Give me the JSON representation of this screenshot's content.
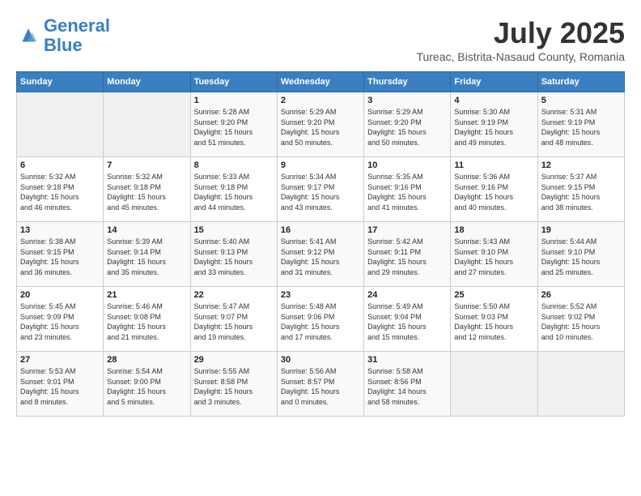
{
  "header": {
    "logo_line1": "General",
    "logo_line2": "Blue",
    "month": "July 2025",
    "location": "Tureac, Bistrita-Nasaud County, Romania"
  },
  "days_of_week": [
    "Sunday",
    "Monday",
    "Tuesday",
    "Wednesday",
    "Thursday",
    "Friday",
    "Saturday"
  ],
  "weeks": [
    [
      {
        "day": "",
        "info": ""
      },
      {
        "day": "",
        "info": ""
      },
      {
        "day": "1",
        "info": "Sunrise: 5:28 AM\nSunset: 9:20 PM\nDaylight: 15 hours\nand 51 minutes."
      },
      {
        "day": "2",
        "info": "Sunrise: 5:29 AM\nSunset: 9:20 PM\nDaylight: 15 hours\nand 50 minutes."
      },
      {
        "day": "3",
        "info": "Sunrise: 5:29 AM\nSunset: 9:20 PM\nDaylight: 15 hours\nand 50 minutes."
      },
      {
        "day": "4",
        "info": "Sunrise: 5:30 AM\nSunset: 9:19 PM\nDaylight: 15 hours\nand 49 minutes."
      },
      {
        "day": "5",
        "info": "Sunrise: 5:31 AM\nSunset: 9:19 PM\nDaylight: 15 hours\nand 48 minutes."
      }
    ],
    [
      {
        "day": "6",
        "info": "Sunrise: 5:32 AM\nSunset: 9:18 PM\nDaylight: 15 hours\nand 46 minutes."
      },
      {
        "day": "7",
        "info": "Sunrise: 5:32 AM\nSunset: 9:18 PM\nDaylight: 15 hours\nand 45 minutes."
      },
      {
        "day": "8",
        "info": "Sunrise: 5:33 AM\nSunset: 9:18 PM\nDaylight: 15 hours\nand 44 minutes."
      },
      {
        "day": "9",
        "info": "Sunrise: 5:34 AM\nSunset: 9:17 PM\nDaylight: 15 hours\nand 43 minutes."
      },
      {
        "day": "10",
        "info": "Sunrise: 5:35 AM\nSunset: 9:16 PM\nDaylight: 15 hours\nand 41 minutes."
      },
      {
        "day": "11",
        "info": "Sunrise: 5:36 AM\nSunset: 9:16 PM\nDaylight: 15 hours\nand 40 minutes."
      },
      {
        "day": "12",
        "info": "Sunrise: 5:37 AM\nSunset: 9:15 PM\nDaylight: 15 hours\nand 38 minutes."
      }
    ],
    [
      {
        "day": "13",
        "info": "Sunrise: 5:38 AM\nSunset: 9:15 PM\nDaylight: 15 hours\nand 36 minutes."
      },
      {
        "day": "14",
        "info": "Sunrise: 5:39 AM\nSunset: 9:14 PM\nDaylight: 15 hours\nand 35 minutes."
      },
      {
        "day": "15",
        "info": "Sunrise: 5:40 AM\nSunset: 9:13 PM\nDaylight: 15 hours\nand 33 minutes."
      },
      {
        "day": "16",
        "info": "Sunrise: 5:41 AM\nSunset: 9:12 PM\nDaylight: 15 hours\nand 31 minutes."
      },
      {
        "day": "17",
        "info": "Sunrise: 5:42 AM\nSunset: 9:11 PM\nDaylight: 15 hours\nand 29 minutes."
      },
      {
        "day": "18",
        "info": "Sunrise: 5:43 AM\nSunset: 9:10 PM\nDaylight: 15 hours\nand 27 minutes."
      },
      {
        "day": "19",
        "info": "Sunrise: 5:44 AM\nSunset: 9:10 PM\nDaylight: 15 hours\nand 25 minutes."
      }
    ],
    [
      {
        "day": "20",
        "info": "Sunrise: 5:45 AM\nSunset: 9:09 PM\nDaylight: 15 hours\nand 23 minutes."
      },
      {
        "day": "21",
        "info": "Sunrise: 5:46 AM\nSunset: 9:08 PM\nDaylight: 15 hours\nand 21 minutes."
      },
      {
        "day": "22",
        "info": "Sunrise: 5:47 AM\nSunset: 9:07 PM\nDaylight: 15 hours\nand 19 minutes."
      },
      {
        "day": "23",
        "info": "Sunrise: 5:48 AM\nSunset: 9:06 PM\nDaylight: 15 hours\nand 17 minutes."
      },
      {
        "day": "24",
        "info": "Sunrise: 5:49 AM\nSunset: 9:04 PM\nDaylight: 15 hours\nand 15 minutes."
      },
      {
        "day": "25",
        "info": "Sunrise: 5:50 AM\nSunset: 9:03 PM\nDaylight: 15 hours\nand 12 minutes."
      },
      {
        "day": "26",
        "info": "Sunrise: 5:52 AM\nSunset: 9:02 PM\nDaylight: 15 hours\nand 10 minutes."
      }
    ],
    [
      {
        "day": "27",
        "info": "Sunrise: 5:53 AM\nSunset: 9:01 PM\nDaylight: 15 hours\nand 8 minutes."
      },
      {
        "day": "28",
        "info": "Sunrise: 5:54 AM\nSunset: 9:00 PM\nDaylight: 15 hours\nand 5 minutes."
      },
      {
        "day": "29",
        "info": "Sunrise: 5:55 AM\nSunset: 8:58 PM\nDaylight: 15 hours\nand 3 minutes."
      },
      {
        "day": "30",
        "info": "Sunrise: 5:56 AM\nSunset: 8:57 PM\nDaylight: 15 hours\nand 0 minutes."
      },
      {
        "day": "31",
        "info": "Sunrise: 5:58 AM\nSunset: 8:56 PM\nDaylight: 14 hours\nand 58 minutes."
      },
      {
        "day": "",
        "info": ""
      },
      {
        "day": "",
        "info": ""
      }
    ]
  ]
}
